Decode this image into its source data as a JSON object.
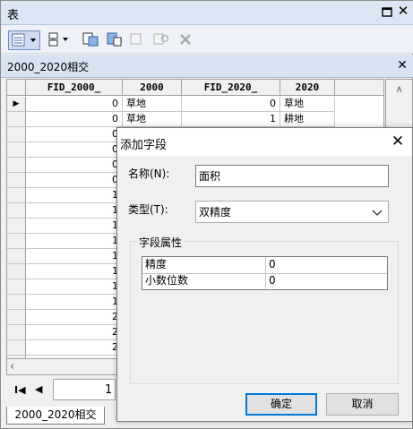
{
  "window": {
    "title": "表"
  },
  "table_tab": {
    "title": "2000_2020相交"
  },
  "grid": {
    "columns": [
      "FID_2000_",
      "2000",
      "FID_2020_",
      "2020"
    ],
    "rows": [
      {
        "fid2000": "0",
        "c2000": "草地",
        "fid2020": "0",
        "c2020": "草地"
      },
      {
        "fid2000": "0",
        "c2000": "草地",
        "fid2020": "1",
        "c2020": "耕地"
      },
      {
        "fid2000": "0",
        "c2000": "",
        "fid2020": "",
        "c2020": ""
      },
      {
        "fid2000": "0",
        "c2000": "",
        "fid2020": "",
        "c2020": ""
      },
      {
        "fid2000": "0",
        "c2000": "",
        "fid2020": "",
        "c2020": ""
      },
      {
        "fid2000": "0",
        "c2000": "",
        "fid2020": "",
        "c2020": ""
      },
      {
        "fid2000": "1",
        "c2000": "",
        "fid2020": "",
        "c2020": ""
      },
      {
        "fid2000": "1",
        "c2000": "",
        "fid2020": "",
        "c2020": ""
      },
      {
        "fid2000": "1",
        "c2000": "",
        "fid2020": "",
        "c2020": ""
      },
      {
        "fid2000": "1",
        "c2000": "",
        "fid2020": "",
        "c2020": ""
      },
      {
        "fid2000": "1",
        "c2000": "",
        "fid2020": "",
        "c2020": ""
      },
      {
        "fid2000": "1",
        "c2000": "",
        "fid2020": "",
        "c2020": ""
      },
      {
        "fid2000": "1",
        "c2000": "",
        "fid2020": "",
        "c2020": ""
      },
      {
        "fid2000": "1",
        "c2000": "",
        "fid2020": "",
        "c2020": ""
      },
      {
        "fid2000": "2",
        "c2000": "",
        "fid2020": "",
        "c2020": ""
      },
      {
        "fid2000": "2",
        "c2000": "",
        "fid2020": "",
        "c2020": ""
      },
      {
        "fid2000": "2",
        "c2000": "",
        "fid2020": "",
        "c2020": ""
      },
      {
        "fid2000": "2",
        "c2000": "",
        "fid2020": "",
        "c2020": ""
      }
    ]
  },
  "navigation": {
    "current_record": "1"
  },
  "bottom_tab": {
    "label": "2000_2020相交"
  },
  "dialog": {
    "title": "添加字段",
    "name_label": "名称(N):",
    "name_value": "面积",
    "type_label": "类型(T):",
    "type_value": "双精度",
    "group_title": "字段属性",
    "properties": [
      {
        "key": "精度",
        "value": "0"
      },
      {
        "key": "小数位数",
        "value": "0"
      }
    ],
    "ok_label": "确定",
    "cancel_label": "取消"
  },
  "colors": {
    "accent": "#0078d7",
    "titlebar": "#dbe6f4"
  }
}
